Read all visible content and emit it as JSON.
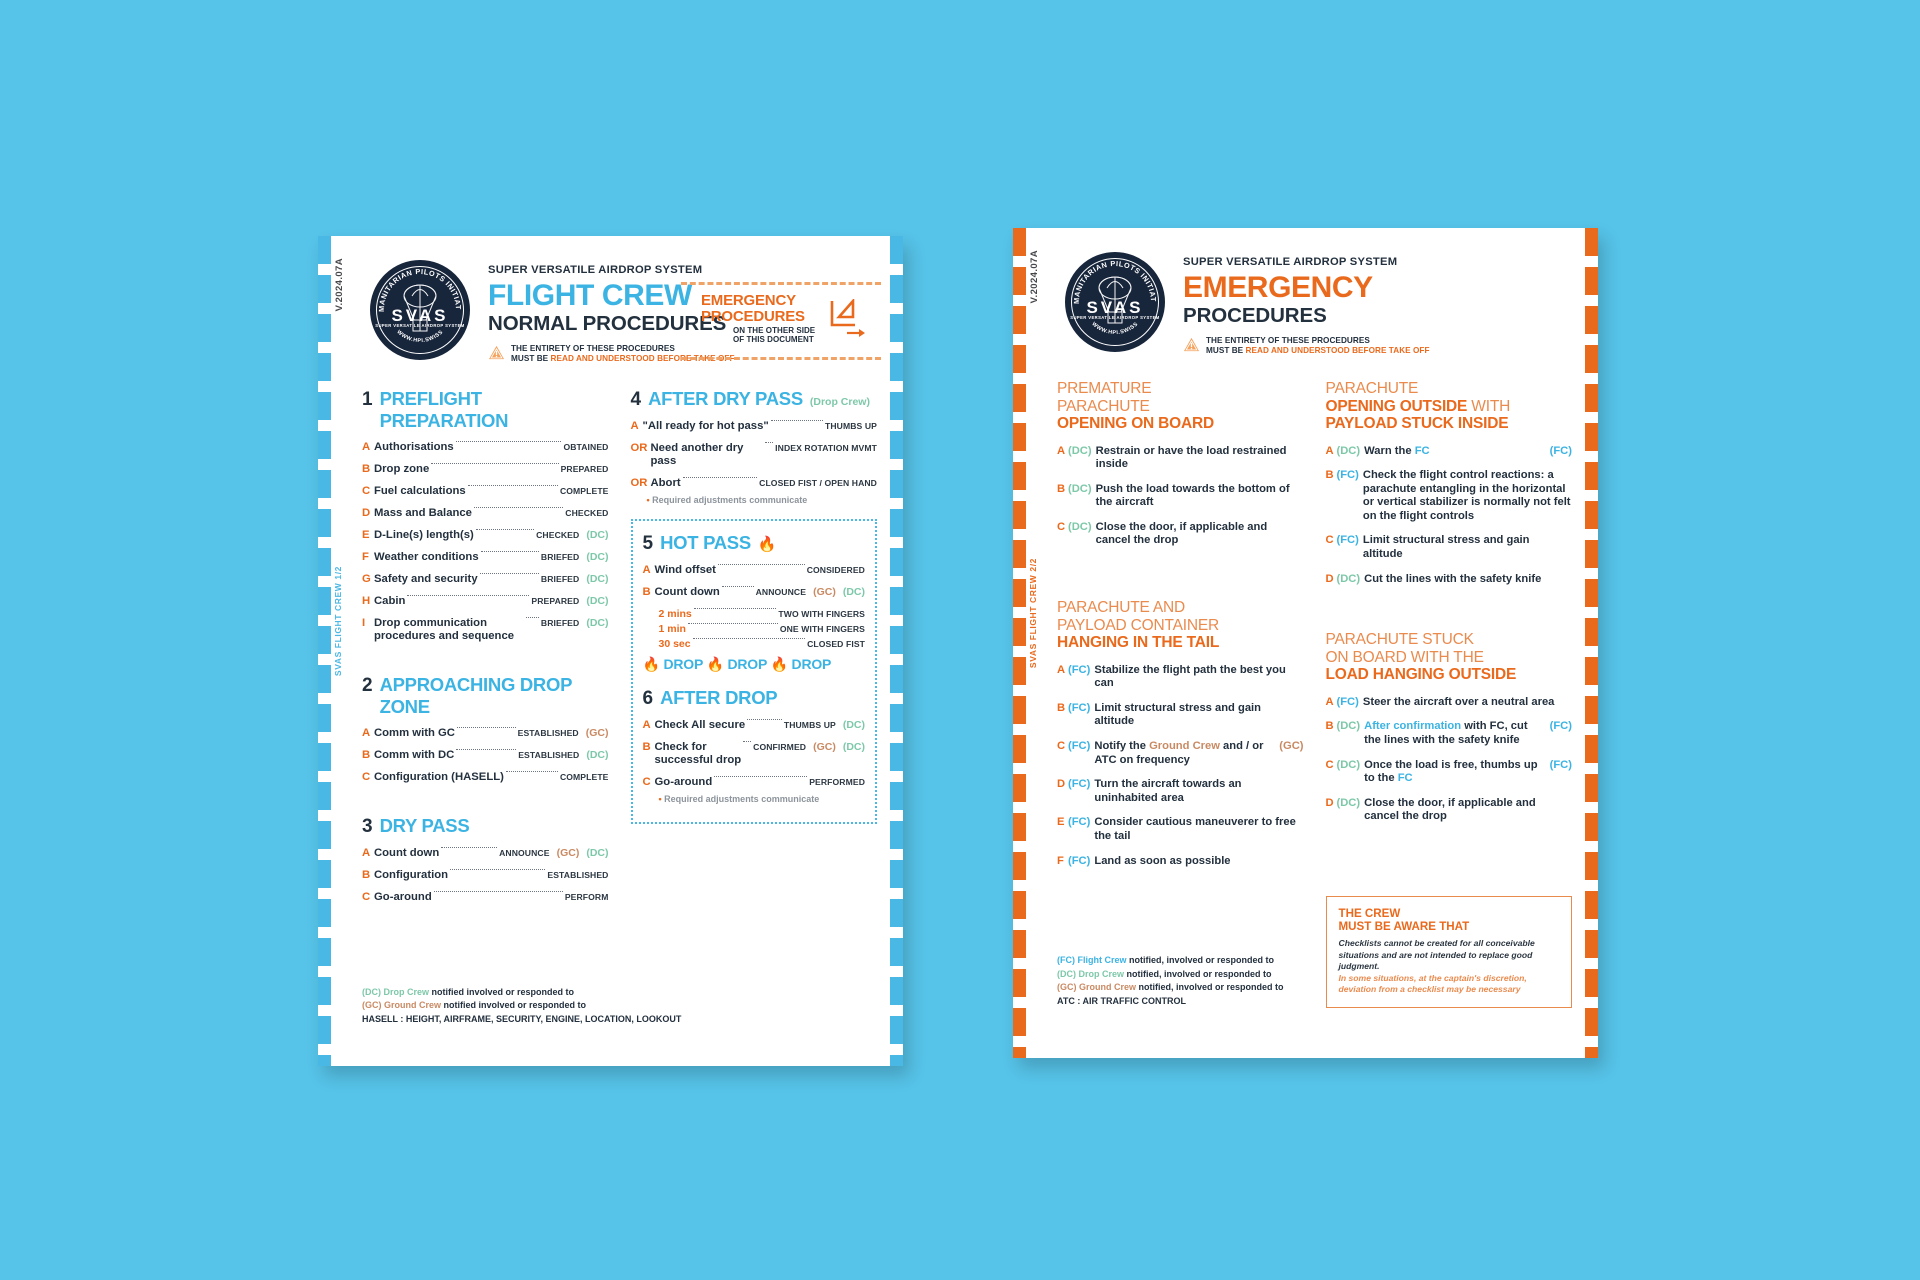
{
  "page": {
    "background": "#56c3e8"
  },
  "colors": {
    "blue": "#3bb3e3",
    "orange": "#ea6a1d",
    "dc_green": "#7dc8a9",
    "gc_brown": "#c98a63",
    "navy": "#23303e"
  },
  "left": {
    "version_code": "V.2024.07A",
    "side_tab": "SVAS FLIGHT CREW 1/2",
    "logo": {
      "ring_top": "HUMANITARIAN PILOTS INITIATIVE",
      "ring_bottom": "WWW.HPI.SWISS",
      "mark": "SVAS",
      "mark_sub": "SUPER VERSATILE AIRDROP SYSTEM"
    },
    "superline": "SUPER VERSATILE AIRDROP SYSTEM",
    "title_big": "FLIGHT CREW",
    "title_sub": "NORMAL PROCEDURES",
    "warning_line1": "THE ENTIRETY OF THESE PROCEDURES",
    "warning_line2_a": "MUST BE ",
    "warning_line2_b": "READ AND UNDERSTOOD BEFORE TAKE OFF",
    "flag": {
      "title1": "EMERGENCY",
      "title2": "PROCEDURES",
      "sub1": "ON THE OTHER SIDE",
      "sub2": "OF THIS DOCUMENT"
    },
    "sections": {
      "s1": {
        "num": "1",
        "title": "PREFLIGHT PREPARATION",
        "rows": [
          {
            "l": "A",
            "name": "Authorisations",
            "act": "OBTAINED",
            "tags": []
          },
          {
            "l": "B",
            "name": "Drop zone",
            "act": "PREPARED",
            "tags": []
          },
          {
            "l": "C",
            "name": "Fuel calculations",
            "act": "COMPLETE",
            "tags": []
          },
          {
            "l": "D",
            "name": "Mass and Balance",
            "act": "CHECKED",
            "tags": []
          },
          {
            "l": "E",
            "name": "D-Line(s) length(s)",
            "act": "CHECKED",
            "tags": [
              "(DC)"
            ]
          },
          {
            "l": "F",
            "name": "Weather conditions",
            "act": "BRIEFED",
            "tags": [
              "(DC)"
            ]
          },
          {
            "l": "G",
            "name": "Safety and security",
            "act": "BRIEFED",
            "tags": [
              "(DC)"
            ]
          },
          {
            "l": "H",
            "name": "Cabin",
            "act": "PREPARED",
            "tags": [
              "(DC)"
            ]
          },
          {
            "l": "I",
            "name": "Drop communication procedures and sequence",
            "act": "BRIEFED",
            "tags": [
              "(DC)"
            ]
          }
        ]
      },
      "s2": {
        "num": "2",
        "title": "APPROACHING DROP ZONE",
        "rows": [
          {
            "l": "A",
            "name": "Comm with GC",
            "act": "ESTABLISHED",
            "tags": [
              "(GC)"
            ]
          },
          {
            "l": "B",
            "name": "Comm with DC",
            "act": "ESTABLISHED",
            "tags": [
              "(DC)"
            ]
          },
          {
            "l": "C",
            "name": "Configuration (HASELL)",
            "act": "COMPLETE",
            "tags": []
          }
        ]
      },
      "s3": {
        "num": "3",
        "title": "DRY PASS",
        "rows": [
          {
            "l": "A",
            "name": "Count down",
            "act": "ANNOUNCE",
            "tags": [
              "(GC)",
              "(DC)"
            ]
          },
          {
            "l": "B",
            "name": "Configuration",
            "act": "ESTABLISHED",
            "tags": []
          },
          {
            "l": "C",
            "name": "Go-around",
            "act": "PERFORM",
            "tags": []
          }
        ]
      },
      "s4": {
        "num": "4",
        "title": "AFTER DRY PASS",
        "note": "(Drop Crew)",
        "rows": [
          {
            "l": "A",
            "name": "\"All ready for hot pass\"",
            "act": "THUMBS UP",
            "tags": []
          },
          {
            "l": "OR",
            "name": "Need another dry pass",
            "act": "INDEX ROTATION MVMT",
            "tags": []
          },
          {
            "l": "OR",
            "name": "Abort",
            "act": "CLOSED FIST / OPEN HAND",
            "tags": []
          }
        ],
        "bullet": "Required adjustments communicate"
      },
      "s5": {
        "num": "5",
        "title": "HOT PASS",
        "rows": [
          {
            "l": "A",
            "name": "Wind offset",
            "act": "CONSIDERED",
            "tags": []
          },
          {
            "l": "B",
            "name": "Count down",
            "act": "ANNOUNCE",
            "tags": [
              "(GC)",
              "(DC)"
            ]
          }
        ],
        "subrows": [
          {
            "name": "2 mins",
            "act": "TWO WITH FINGERS"
          },
          {
            "name": "1 min",
            "act": "ONE WITH FINGERS"
          },
          {
            "name": "30 sec",
            "act": "CLOSED FIST"
          }
        ],
        "drops": "DROP"
      },
      "s6": {
        "num": "6",
        "title": "AFTER DROP",
        "rows": [
          {
            "l": "A",
            "name": "Check All secure",
            "act": "THUMBS UP",
            "tags": [
              "(DC)"
            ]
          },
          {
            "l": "B",
            "name": "Check for successful drop",
            "act": "CONFIRMED",
            "tags": [
              "(GC)",
              "(DC)"
            ]
          },
          {
            "l": "C",
            "name": "Go-around",
            "act": "PERFORMED",
            "tags": []
          }
        ],
        "bullet": "Required adjustments communicate"
      }
    },
    "legend": {
      "dc_tag": "(DC) Drop Crew",
      "dc_text": " notified involved or responded to",
      "gc_tag": "(GC) Ground Crew",
      "gc_text": " notified involved or responded to",
      "hasell_label": "HASELL :",
      "hasell_text": " HEIGHT, AIRFRAME, SECURITY, ENGINE, LOCATION, LOOKOUT"
    }
  },
  "right": {
    "version_code": "V.2024.07A",
    "side_tab": "SVAS FLIGHT CREW 2/2",
    "logo": {
      "ring_top": "HUMANITARIAN PILOTS INITIATIVE",
      "ring_bottom": "WWW.HPI.SWISS",
      "mark": "SVAS",
      "mark_sub": "SUPER VERSATILE AIRDROP SYSTEM"
    },
    "superline": "SUPER VERSATILE AIRDROP SYSTEM",
    "title_big": "EMERGENCY",
    "title_sub": "PROCEDURES",
    "warning_line1": "THE ENTIRETY OF THESE PROCEDURES",
    "warning_line2_a": "MUST BE ",
    "warning_line2_b": "READ AND UNDERSTOOD BEFORE TAKE OFF",
    "sections": {
      "e1": {
        "h1": "PREMATURE",
        "h2": "PARACHUTE",
        "h3": "OPENING ON BOARD",
        "rows": [
          {
            "l": "A",
            "who": "(DC)",
            "who_c": "dc",
            "text": "Restrain or have the load restrained inside",
            "rt": "",
            "rt_c": ""
          },
          {
            "l": "B",
            "who": "(DC)",
            "who_c": "dc",
            "text": "Push the load towards the bottom of the aircraft",
            "rt": "",
            "rt_c": ""
          },
          {
            "l": "C",
            "who": "(DC)",
            "who_c": "dc",
            "text": "Close the door, if applicable and cancel the drop",
            "rt": "",
            "rt_c": ""
          }
        ]
      },
      "e2": {
        "h1": "PARACHUTE",
        "h2": "OPENING OUTSIDE",
        "h2b": " WITH",
        "h3": "PAYLOAD STUCK INSIDE",
        "rows": [
          {
            "l": "A",
            "who": "(DC)",
            "who_c": "dc",
            "text": "Warn the FC",
            "hl": "FC",
            "rt": "(FC)",
            "rt_c": "fc"
          },
          {
            "l": "B",
            "who": "(FC)",
            "who_c": "fc",
            "text": "Check the flight control reactions: a parachute entangling in the horizontal or vertical stabilizer is normally not felt on the flight controls",
            "rt": "",
            "rt_c": ""
          },
          {
            "l": "C",
            "who": "(FC)",
            "who_c": "fc",
            "text": "Limit structural stress and gain altitude",
            "rt": "",
            "rt_c": ""
          },
          {
            "l": "D",
            "who": "(DC)",
            "who_c": "dc",
            "text": "Cut the lines with the safety knife",
            "rt": "",
            "rt_c": ""
          }
        ]
      },
      "e3": {
        "h1": "PARACHUTE AND",
        "h2": "PAYLOAD CONTAINER",
        "h3": "HANGING IN THE TAIL",
        "rows": [
          {
            "l": "A",
            "who": "(FC)",
            "who_c": "fc",
            "text": "Stabilize the flight path the best you can",
            "rt": "",
            "rt_c": ""
          },
          {
            "l": "B",
            "who": "(FC)",
            "who_c": "fc",
            "text": "Limit structural stress and gain altitude",
            "rt": "",
            "rt_c": ""
          },
          {
            "l": "C",
            "who": "(FC)",
            "who_c": "fc",
            "text": "Notify the Ground Crew and / or ATC on frequency",
            "hl": "Ground Crew",
            "hl_c": "gc",
            "rt": "(GC)",
            "rt_c": "gc"
          },
          {
            "l": "D",
            "who": "(FC)",
            "who_c": "fc",
            "text": "Turn the aircraft towards an uninhabited area",
            "rt": "",
            "rt_c": ""
          },
          {
            "l": "E",
            "who": "(FC)",
            "who_c": "fc",
            "text": "Consider cautious maneuverer to free the tail",
            "rt": "",
            "rt_c": ""
          },
          {
            "l": "F",
            "who": "(FC)",
            "who_c": "fc",
            "text": "Land as soon as possible",
            "rt": "",
            "rt_c": ""
          }
        ]
      },
      "e4": {
        "h1": "PARACHUTE STUCK",
        "h2": "ON BOARD WITH THE",
        "h3": "LOAD HANGING OUTSIDE",
        "rows": [
          {
            "l": "A",
            "who": "(FC)",
            "who_c": "fc",
            "text": "Steer the aircraft over a neutral area",
            "rt": "",
            "rt_c": ""
          },
          {
            "l": "B",
            "who": "(DC)",
            "who_c": "dc",
            "text": "After confirmation with FC, cut the lines with the safety knife",
            "hl": "After confirmation",
            "hl_c": "fc",
            "rt": "(FC)",
            "rt_c": "fc"
          },
          {
            "l": "C",
            "who": "(DC)",
            "who_c": "dc",
            "text": "Once the load is free, thumbs up to the FC",
            "hl": "FC",
            "hl_c": "fc",
            "rt": "(FC)",
            "rt_c": "fc"
          },
          {
            "l": "D",
            "who": "(DC)",
            "who_c": "dc",
            "text": "Close the door, if applicable and cancel the drop",
            "rt": "",
            "rt_c": ""
          }
        ]
      }
    },
    "aware": {
      "title1": "THE CREW",
      "title2": "MUST BE AWARE THAT",
      "p1": "Checklists cannot be created for all conceivable situations and are not intended to replace good judgment.",
      "p2": "In some situations, at the captain's discretion, deviation from a checklist may be necessary"
    },
    "legend": {
      "fc_tag": "(FC) Flight Crew",
      "fc_text": " notified, involved or responded to",
      "dc_tag": "(DC) Drop Crew",
      "dc_text": " notified, involved or responded to",
      "gc_tag": "(GC) Ground Crew",
      "gc_text": " notified, involved or responded to",
      "atc_label": "ATC :",
      "atc_text": " AIR TRAFFIC CONTROL"
    }
  }
}
